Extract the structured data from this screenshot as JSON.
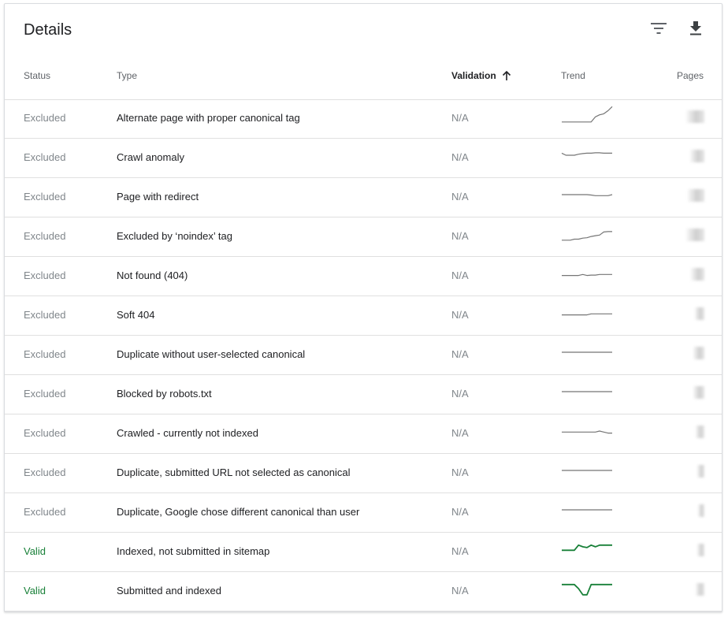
{
  "header": {
    "title": "Details"
  },
  "toolbar": {
    "filter_icon": "filter-icon",
    "download_icon": "download-icon"
  },
  "colors": {
    "excluded_status": "#80868b",
    "valid_status": "#188038",
    "excluded_trend": "#757575",
    "valid_trend": "#188038"
  },
  "columns": {
    "status": "Status",
    "type": "Type",
    "validation": "Validation",
    "validation_sort": "arrow-up-icon",
    "trend": "Trend",
    "pages": "Pages"
  },
  "rows": [
    {
      "status": "Excluded",
      "type": "Alternate page with proper canonical tag",
      "validation": "N/A",
      "trend": [
        0.2,
        0.2,
        0.2,
        0.2,
        0.2,
        0.2,
        0.2,
        0.2,
        0.45,
        0.55,
        0.6,
        0.75,
        0.95
      ]
    },
    {
      "status": "Excluded",
      "type": "Crawl anomaly",
      "validation": "N/A",
      "trend": [
        0.6,
        0.5,
        0.5,
        0.5,
        0.55,
        0.58,
        0.6,
        0.6,
        0.62,
        0.62,
        0.6,
        0.6,
        0.6
      ]
    },
    {
      "status": "Excluded",
      "type": "Page with redirect",
      "validation": "N/A",
      "trend": [
        0.5,
        0.5,
        0.5,
        0.5,
        0.5,
        0.5,
        0.5,
        0.48,
        0.45,
        0.45,
        0.45,
        0.45,
        0.5
      ]
    },
    {
      "status": "Excluded",
      "type": "Excluded by ‘noindex’ tag",
      "validation": "N/A",
      "trend": [
        0.2,
        0.2,
        0.2,
        0.25,
        0.25,
        0.3,
        0.32,
        0.38,
        0.42,
        0.45,
        0.6,
        0.62,
        0.62
      ]
    },
    {
      "status": "Excluded",
      "type": "Not found (404)",
      "validation": "N/A",
      "trend": [
        0.4,
        0.4,
        0.4,
        0.4,
        0.4,
        0.45,
        0.4,
        0.42,
        0.42,
        0.45,
        0.45,
        0.45,
        0.45
      ]
    },
    {
      "status": "Excluded",
      "type": "Soft 404",
      "validation": "N/A",
      "trend": [
        0.4,
        0.4,
        0.4,
        0.4,
        0.4,
        0.4,
        0.4,
        0.45,
        0.45,
        0.45,
        0.45,
        0.45,
        0.45
      ]
    },
    {
      "status": "Excluded",
      "type": "Duplicate without user-selected canonical",
      "validation": "N/A",
      "trend": [
        0.5,
        0.5,
        0.5,
        0.5,
        0.5,
        0.5,
        0.5,
        0.5,
        0.5,
        0.5,
        0.5,
        0.5,
        0.5
      ]
    },
    {
      "status": "Excluded",
      "type": "Blocked by robots.txt",
      "validation": "N/A",
      "trend": [
        0.5,
        0.5,
        0.5,
        0.5,
        0.5,
        0.5,
        0.5,
        0.5,
        0.5,
        0.5,
        0.5,
        0.5,
        0.5
      ]
    },
    {
      "status": "Excluded",
      "type": "Crawled - currently not indexed",
      "validation": "N/A",
      "trend": [
        0.45,
        0.45,
        0.45,
        0.45,
        0.45,
        0.45,
        0.45,
        0.45,
        0.45,
        0.5,
        0.45,
        0.4,
        0.4
      ]
    },
    {
      "status": "Excluded",
      "type": "Duplicate, submitted URL not selected as canonical",
      "validation": "N/A",
      "trend": [
        0.5,
        0.5,
        0.5,
        0.5,
        0.5,
        0.5,
        0.5,
        0.5,
        0.5,
        0.5,
        0.5,
        0.5,
        0.5
      ]
    },
    {
      "status": "Excluded",
      "type": "Duplicate, Google chose different canonical than user",
      "validation": "N/A",
      "trend": [
        0.5,
        0.5,
        0.5,
        0.5,
        0.5,
        0.5,
        0.5,
        0.5,
        0.5,
        0.5,
        0.5,
        0.5,
        0.5
      ]
    },
    {
      "status": "Valid",
      "type": "Indexed, not submitted in sitemap",
      "validation": "N/A",
      "trend": [
        0.45,
        0.45,
        0.45,
        0.45,
        0.7,
        0.62,
        0.58,
        0.7,
        0.62,
        0.7,
        0.7,
        0.7,
        0.7
      ]
    },
    {
      "status": "Valid",
      "type": "Submitted and indexed",
      "validation": "N/A",
      "trend": [
        0.7,
        0.7,
        0.7,
        0.7,
        0.5,
        0.2,
        0.2,
        0.7,
        0.7,
        0.7,
        0.7,
        0.7,
        0.7
      ]
    }
  ],
  "pages_blur_levels": [
    0.75,
    0.6,
    0.7,
    0.75,
    0.55,
    0.4,
    0.45,
    0.45,
    0.35,
    0.3,
    0.25,
    0.3,
    0.35
  ]
}
